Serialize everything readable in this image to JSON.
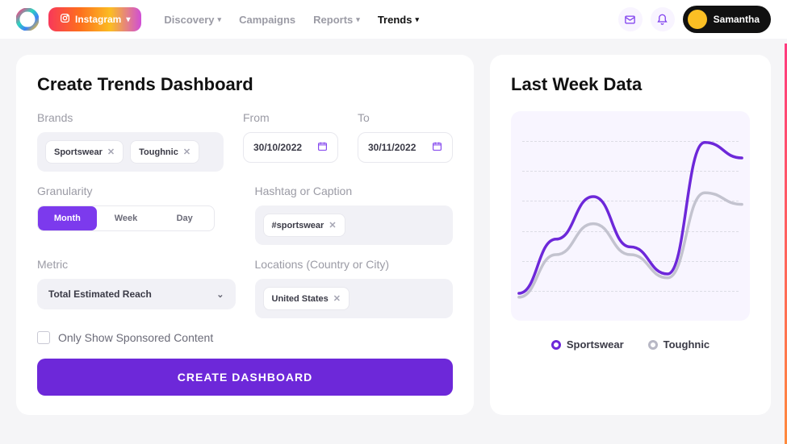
{
  "header": {
    "platform_button": "Instagram",
    "nav": [
      {
        "label": "Discovery",
        "active": false,
        "dropdown": true
      },
      {
        "label": "Campaigns",
        "active": false,
        "dropdown": false
      },
      {
        "label": "Reports",
        "active": false,
        "dropdown": true
      },
      {
        "label": "Trends",
        "active": true,
        "dropdown": true
      }
    ],
    "user_name": "Samantha"
  },
  "form": {
    "title": "Create Trends Dashboard",
    "brands": {
      "label": "Brands",
      "chips": [
        "Sportswear",
        "Toughnic"
      ]
    },
    "from": {
      "label": "From",
      "value": "30/10/2022"
    },
    "to": {
      "label": "To",
      "value": "30/11/2022"
    },
    "granularity": {
      "label": "Granularity",
      "options": [
        "Month",
        "Week",
        "Day"
      ],
      "selected": "Month"
    },
    "hashtag": {
      "label": "Hashtag or Caption",
      "chips": [
        "#sportswear"
      ]
    },
    "metric": {
      "label": "Metric",
      "value": "Total Estimated Reach"
    },
    "locations": {
      "label": "Locations (Country or City)",
      "chips": [
        "United States"
      ]
    },
    "sponsored_label": "Only Show Sponsored Content",
    "submit": "CREATE DASHBOARD"
  },
  "chart": {
    "title": "Last Week Data",
    "legend": [
      "Sportswear",
      "Toughnic"
    ]
  },
  "chart_data": {
    "type": "line",
    "x": [
      0,
      1,
      2,
      3,
      4,
      5,
      6
    ],
    "series": [
      {
        "name": "Sportswear",
        "values": [
          10,
          38,
          60,
          34,
          20,
          88,
          80
        ],
        "color": "#6d28d9"
      },
      {
        "name": "Toughnic",
        "values": [
          8,
          30,
          46,
          30,
          18,
          62,
          56
        ],
        "color": "#c3c3cf"
      }
    ],
    "ylim": [
      0,
      100
    ],
    "gridlines": 6
  }
}
